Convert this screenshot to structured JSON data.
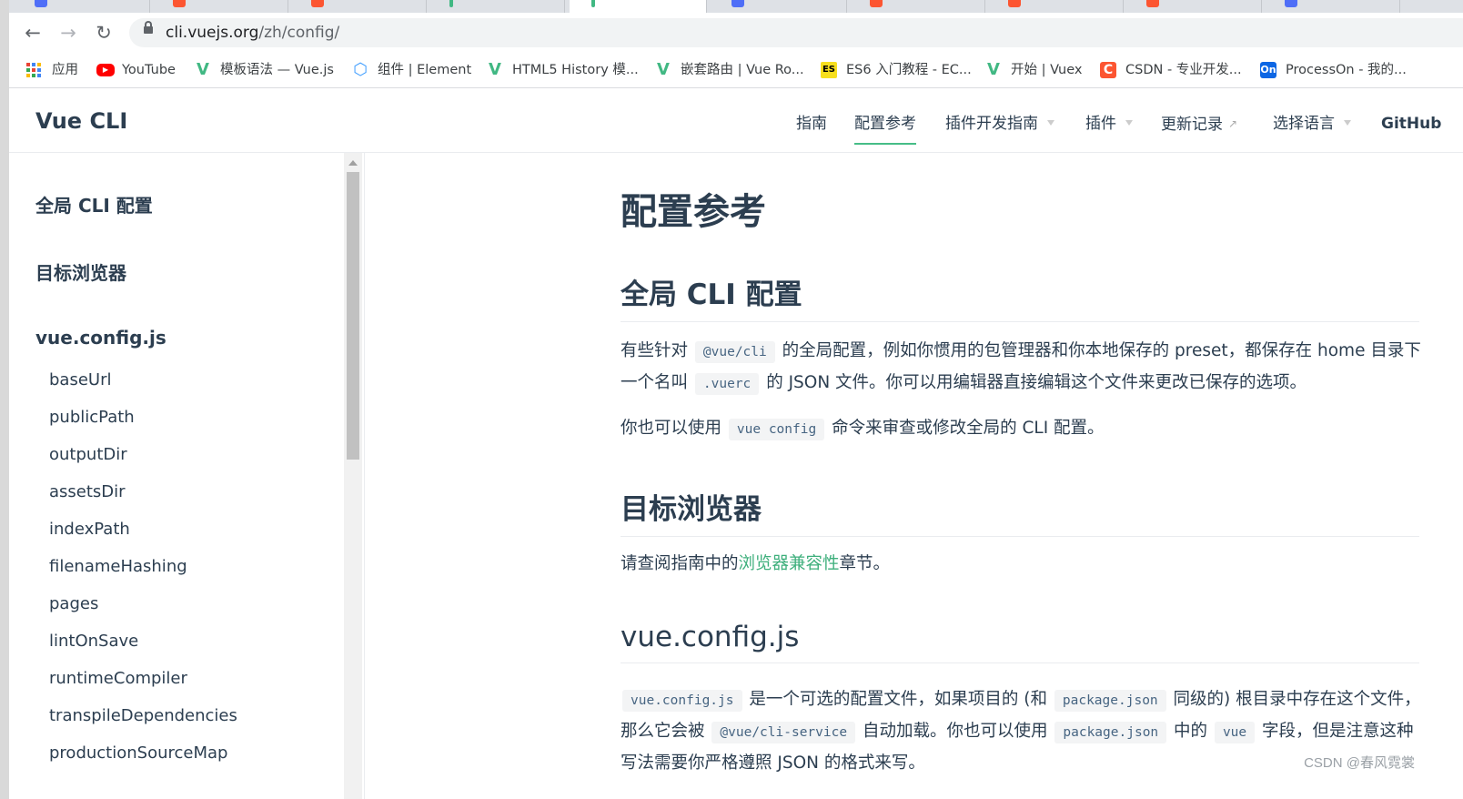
{
  "browser": {
    "url_host": "cli.vuejs.org",
    "url_path": "/zh/config/",
    "bookmarks": [
      {
        "label": "应用",
        "icon": "apps-icon"
      },
      {
        "label": "YouTube",
        "icon": "youtube-icon"
      },
      {
        "label": "模板语法 — Vue.js",
        "icon": "vue-icon"
      },
      {
        "label": "组件 | Element",
        "icon": "element-icon"
      },
      {
        "label": "HTML5 History 模...",
        "icon": "vue-icon"
      },
      {
        "label": "嵌套路由 | Vue Ro...",
        "icon": "vue-icon"
      },
      {
        "label": "ES6 入门教程 - EC...",
        "icon": "es-icon"
      },
      {
        "label": "开始 | Vuex",
        "icon": "vue-icon"
      },
      {
        "label": "CSDN - 专业开发...",
        "icon": "csdn-icon"
      },
      {
        "label": "ProcessOn - 我的...",
        "icon": "processon-icon"
      }
    ]
  },
  "site": {
    "title": "Vue CLI",
    "nav": [
      {
        "label": "指南"
      },
      {
        "label": "配置参考",
        "active": true
      },
      {
        "label": "插件开发指南",
        "dropdown": true
      },
      {
        "label": "插件",
        "dropdown": true
      },
      {
        "label": "更新记录",
        "external": true
      },
      {
        "label": "选择语言",
        "dropdown": true
      },
      {
        "label": "GitHub"
      }
    ]
  },
  "sidebar": {
    "headings": [
      "全局 CLI 配置",
      "目标浏览器",
      "vue.config.js"
    ],
    "items": [
      "baseUrl",
      "publicPath",
      "outputDir",
      "assetsDir",
      "indexPath",
      "filenameHashing",
      "pages",
      "lintOnSave",
      "runtimeCompiler",
      "transpileDependencies",
      "productionSourceMap"
    ]
  },
  "content": {
    "page_title": "配置参考",
    "sec1": {
      "title": "全局 CLI 配置",
      "p1_a": "有些针对",
      "p1_code1": "@vue/cli",
      "p1_b": "的全局配置，例如你惯用的包管理器和你本地保存的 preset，都保存在 home 目录下一个名叫",
      "p1_code2": ".vuerc",
      "p1_c": "的 JSON 文件。你可以用编辑器直接编辑这个文件来更改已保存的选项。",
      "p2_a": "你也可以使用",
      "p2_code": "vue config",
      "p2_b": "命令来审查或修改全局的 CLI 配置。"
    },
    "sec2": {
      "title": "目标浏览器",
      "p_a": "请查阅指南中的",
      "p_link": "浏览器兼容性",
      "p_b": "章节。"
    },
    "sec3": {
      "title": "vue.config.js",
      "code1": "vue.config.js",
      "t1": "是一个可选的配置文件，如果项目的 (和",
      "code2": "package.json",
      "t2": "同级的) 根目录中存在这个文件，那么它会被",
      "code3": "@vue/cli-service",
      "t3": "自动加载。你也可以使用",
      "code4": "package.json",
      "t4": "中的",
      "code5": "vue",
      "t5": "字段，但是注意这种写法需要你严格遵照 JSON 的格式来写。"
    }
  },
  "watermark": "CSDN @春风霓裳",
  "colors": {
    "accent": "#3eaf7c",
    "text": "#2c3e50",
    "code_text": "#476582",
    "code_bg": "#f3f4f5"
  }
}
